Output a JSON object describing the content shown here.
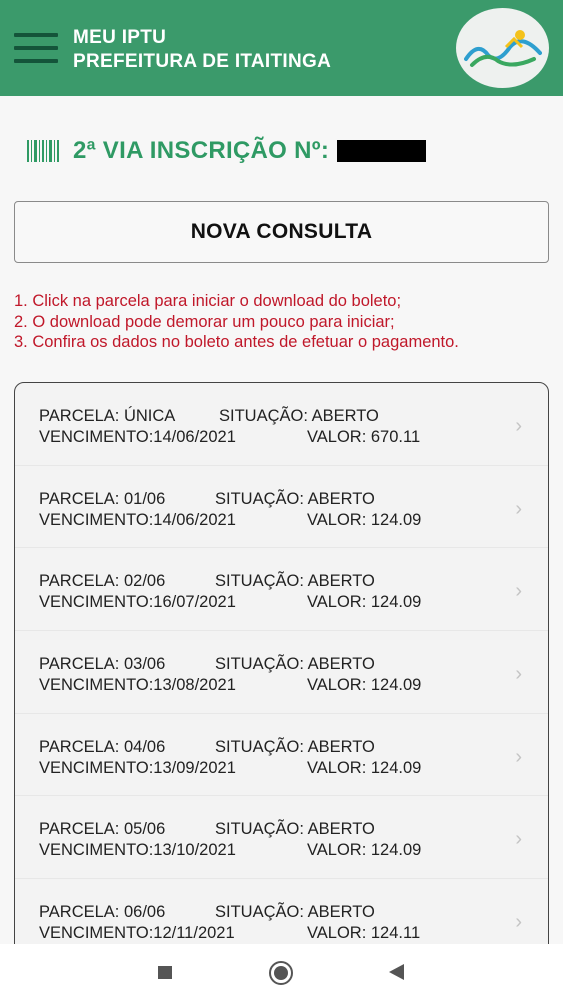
{
  "app": {
    "title_line1": "MEU IPTU",
    "title_line2": "PREFEITURA DE ITAITINGA",
    "accent_color": "#3b9a6b"
  },
  "inscricao": {
    "label": "2ª VIA INSCRIÇÃO Nº:",
    "icon": "barcode-icon"
  },
  "nova_consulta": {
    "label": "NOVA CONSULTA"
  },
  "instructions": [
    "1. Click na parcela para iniciar o download do boleto;",
    "2. O download pode demorar um pouco para iniciar;",
    "3. Confira os dados no boleto antes de efetuar o pagamento."
  ],
  "parcelas": [
    {
      "parcela": "PARCELA: ÚNICA",
      "situacao": "SITUAÇÃO: ABERTO",
      "vencimento": "VENCIMENTO:14/06/2021",
      "valor": "VALOR: 670.11"
    },
    {
      "parcela": "PARCELA: 01/06",
      "situacao": "SITUAÇÃO: ABERTO",
      "vencimento": "VENCIMENTO:14/06/2021",
      "valor": "VALOR: 124.09"
    },
    {
      "parcela": "PARCELA: 02/06",
      "situacao": "SITUAÇÃO: ABERTO",
      "vencimento": "VENCIMENTO:16/07/2021",
      "valor": "VALOR: 124.09"
    },
    {
      "parcela": "PARCELA: 03/06",
      "situacao": "SITUAÇÃO: ABERTO",
      "vencimento": "VENCIMENTO:13/08/2021",
      "valor": "VALOR: 124.09"
    },
    {
      "parcela": "PARCELA: 04/06",
      "situacao": "SITUAÇÃO: ABERTO",
      "vencimento": "VENCIMENTO:13/09/2021",
      "valor": "VALOR: 124.09"
    },
    {
      "parcela": "PARCELA: 05/06",
      "situacao": "SITUAÇÃO: ABERTO",
      "vencimento": "VENCIMENTO:13/10/2021",
      "valor": "VALOR: 124.09"
    },
    {
      "parcela": "PARCELA: 06/06",
      "situacao": "SITUAÇÃO: ABERTO",
      "vencimento": "VENCIMENTO:12/11/2021",
      "valor": "VALOR: 124.11"
    }
  ],
  "navbar": {
    "icons": [
      "recent-apps-icon",
      "home-icon",
      "back-icon"
    ]
  }
}
